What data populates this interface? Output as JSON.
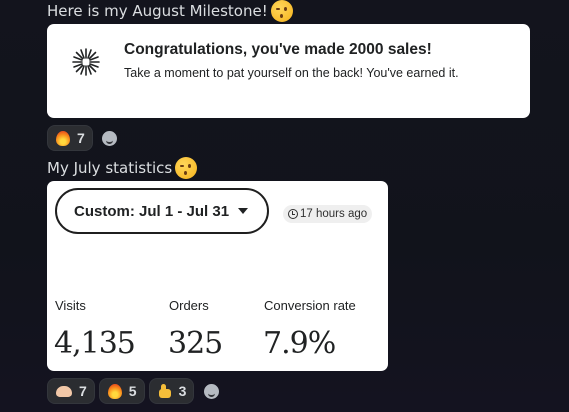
{
  "message1": {
    "text": "Here is my August Milestone!",
    "emoji": "winking-face-icon"
  },
  "milestone": {
    "title": "Congratulations, you've made 2000 sales!",
    "subtitle": "Take a moment to pat yourself on the back! You've earned it.",
    "icon": "starburst-icon"
  },
  "reactions1": [
    {
      "emoji": "fire-icon",
      "count": "7"
    }
  ],
  "message2": {
    "text": "My July statistics",
    "emoji": "winking-face-icon"
  },
  "stats": {
    "filter_label": "Custom: Jul 1 - Jul 31",
    "updated": "17 hours ago",
    "metrics": [
      {
        "label": "Visits",
        "value": "4,135"
      },
      {
        "label": "Orders",
        "value": "325"
      },
      {
        "label": "Conversion rate",
        "value": "7.9%"
      }
    ]
  },
  "reactions2": [
    {
      "emoji": "flexed-biceps-icon",
      "count": "7"
    },
    {
      "emoji": "fire-icon",
      "count": "5"
    },
    {
      "emoji": "thumbs-up-icon",
      "count": "3"
    }
  ],
  "colors": {
    "background": "#13141d",
    "card": "#ffffff",
    "reaction_pill": "#2b2d31"
  }
}
